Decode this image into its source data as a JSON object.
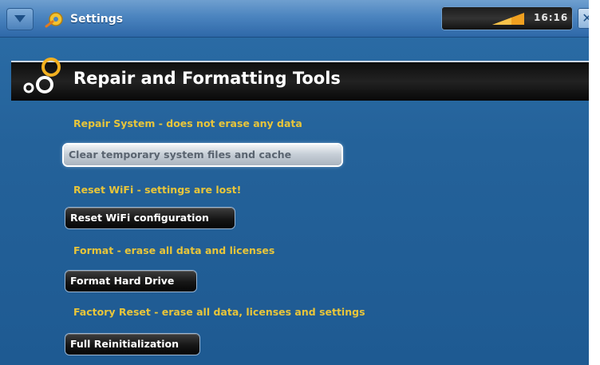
{
  "statusbar": {
    "app_title": "Settings",
    "clock": "16:16",
    "close_glyph": "✕"
  },
  "header": {
    "title": "Repair and Formatting Tools"
  },
  "sections": [
    {
      "label": "Repair System - does not erase any data",
      "button": "Clear temporary system files and cache",
      "selected": true
    },
    {
      "label": "Reset WiFi - settings are lost!",
      "button": "Reset WiFi configuration",
      "selected": false
    },
    {
      "label": "Format - erase all data and licenses",
      "button": "Format Hard Drive",
      "selected": false
    },
    {
      "label": "Factory Reset - erase all data, licenses and settings",
      "button": "Full Reinitialization",
      "selected": false
    }
  ],
  "colors": {
    "background": "#24629a",
    "label_yellow": "#e8c53a",
    "button_dark": "#161616",
    "button_selected": "#c8d0d8"
  },
  "icons": [
    "tab-arrow-icon",
    "settings-icon",
    "signal-icon",
    "close-icon",
    "tools-icon"
  ]
}
